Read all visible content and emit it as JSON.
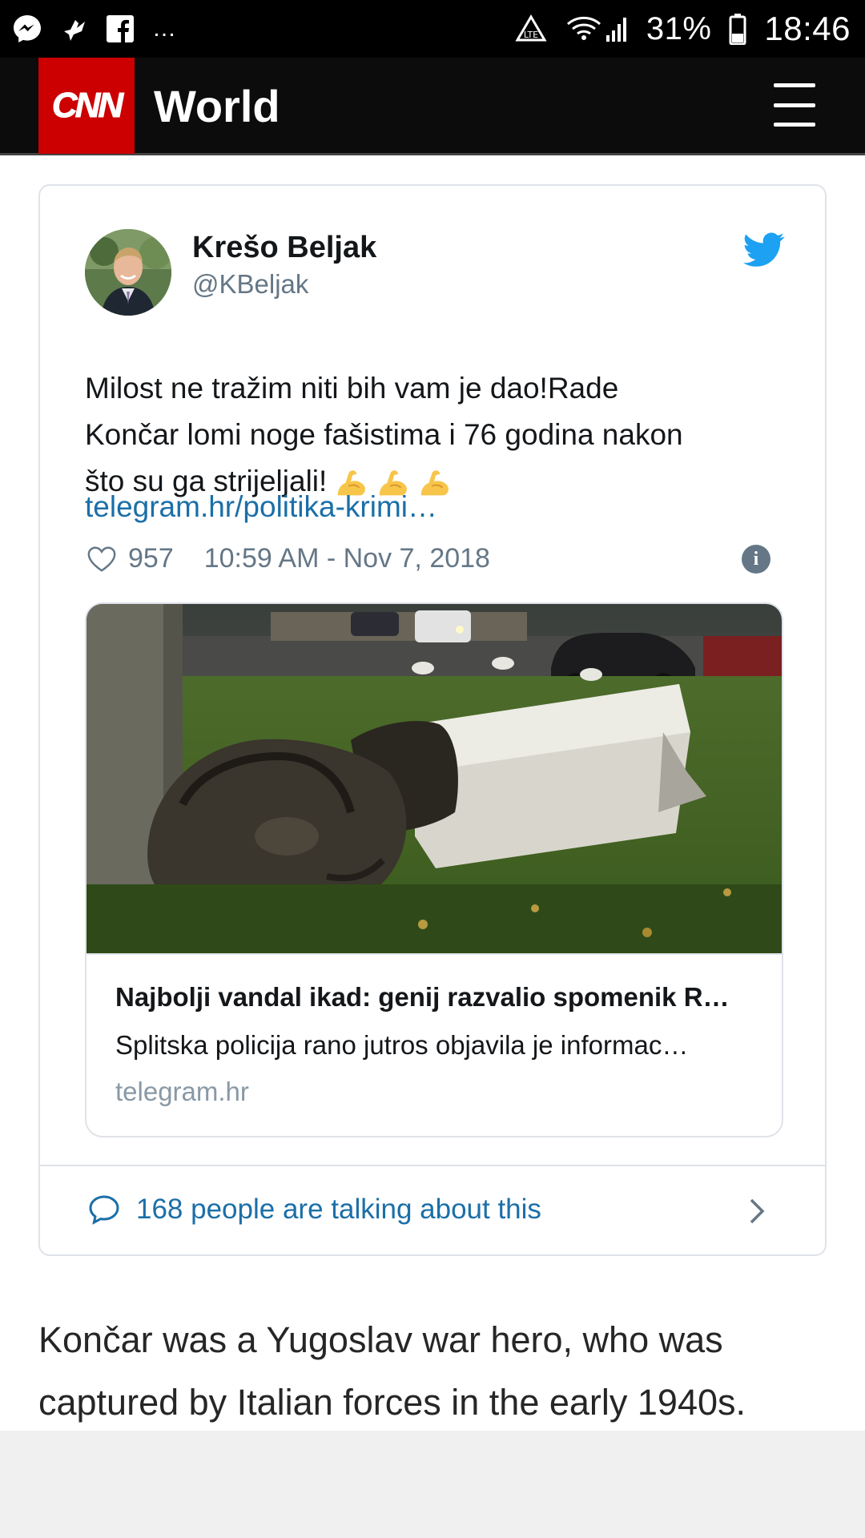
{
  "status_bar": {
    "battery": "31%",
    "time": "18:46",
    "more": "…"
  },
  "header": {
    "logo": "CNN",
    "section": "World"
  },
  "tweet": {
    "author_name": "Krešo Beljak",
    "author_handle": "@KBeljak",
    "text_line1": "Milost ne tražim niti bih vam je dao!Rade",
    "text_line2": "Končar lomi noge fašistima i 76 godina nakon",
    "text_line3": "što su ga strijeljali!",
    "emojis": [
      "flexed-biceps-emoji",
      "flexed-biceps-emoji",
      "flexed-biceps-emoji"
    ],
    "link": "telegram.hr/politika-krimi…",
    "likes": "957",
    "timestamp": "10:59 AM - Nov 7, 2018",
    "link_card": {
      "title": "Najbolji vandal ikad: genij razvalio spomenik R…",
      "description": "Splitska policija rano jutros objavila je informac…",
      "domain": "telegram.hr"
    },
    "talking": "168 people are talking about this"
  },
  "article": {
    "paragraph": "Končar was a Yugoslav war hero, who was captured by Italian forces in the early 1940s."
  },
  "colors": {
    "cnn_red": "#cc0000",
    "twitter_blue": "#1da1f2",
    "link_blue": "#1b6fa8",
    "muted": "#657786"
  }
}
